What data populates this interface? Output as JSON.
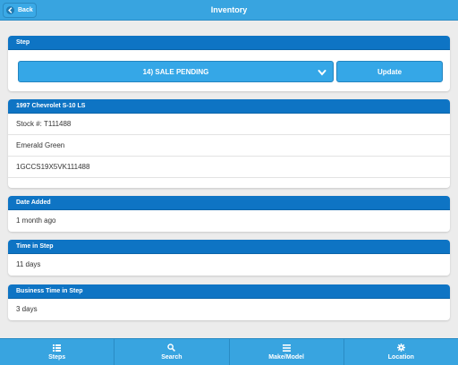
{
  "header": {
    "title": "Inventory",
    "back_label": "Back"
  },
  "step_card": {
    "title": "Step",
    "selected_step": "14) SALE PENDING",
    "update_label": "Update"
  },
  "vehicle_card": {
    "title": "1997 Chevrolet S-10 LS",
    "stock": "Stock #: T111488",
    "color": "Emerald Green",
    "vin": "1GCCS19X5VK111488"
  },
  "date_added": {
    "title": "Date Added",
    "value": "1 month ago"
  },
  "time_in_step": {
    "title": "Time in Step",
    "value": "11 days"
  },
  "business_time": {
    "title": "Business Time in Step",
    "value": "3 days"
  },
  "footer": {
    "items": [
      {
        "label": "Steps",
        "icon": "list-icon"
      },
      {
        "label": "Search",
        "icon": "search-icon"
      },
      {
        "label": "Make/Model",
        "icon": "menu-icon"
      },
      {
        "label": "Location",
        "icon": "gear-icon"
      }
    ]
  },
  "colors": {
    "header": "#38a4e0",
    "card_header": "#0e74c4",
    "button": "#35a7e7",
    "background": "#ececec"
  }
}
